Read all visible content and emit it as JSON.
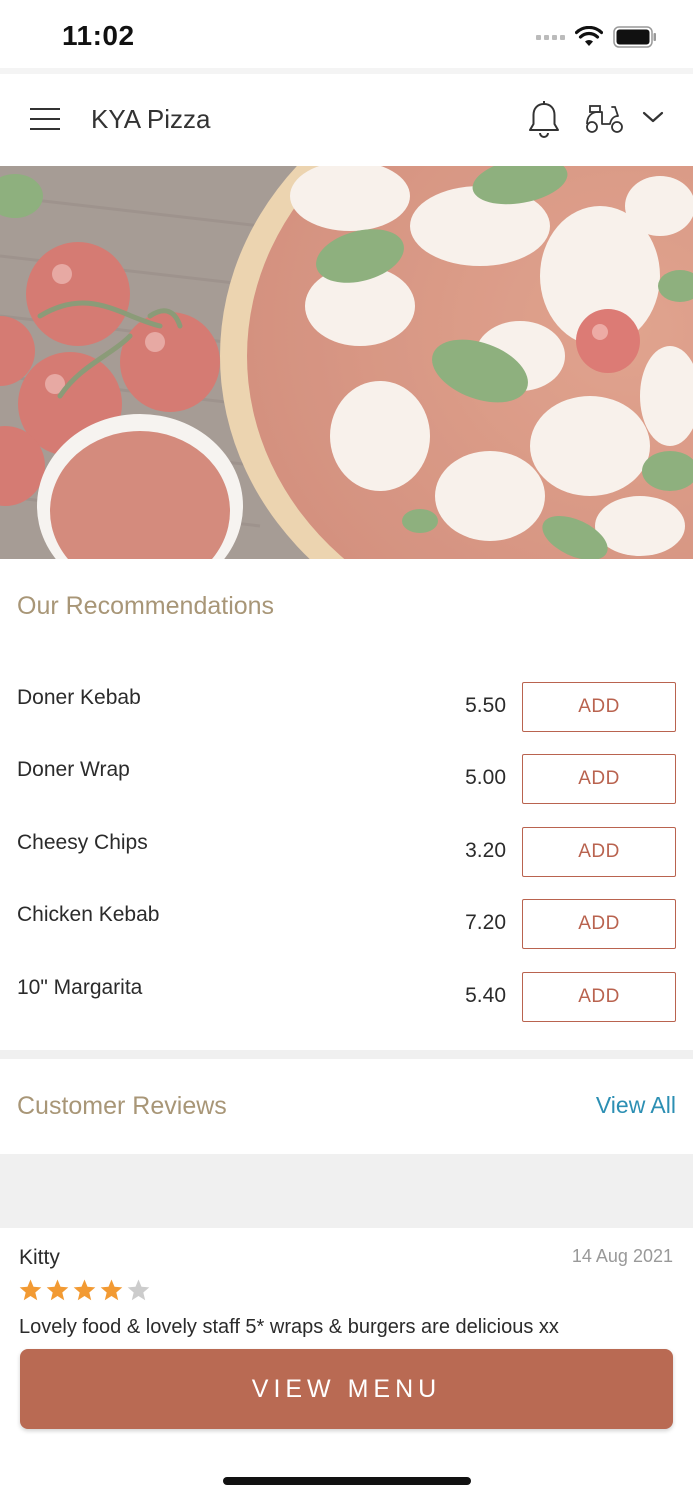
{
  "status_bar": {
    "time": "11:02"
  },
  "header": {
    "title": "KYA Pizza"
  },
  "recommendations": {
    "title": "Our Recommendations",
    "add_label": "ADD",
    "items": [
      {
        "name": "Doner Kebab",
        "price": "5.50"
      },
      {
        "name": "Doner Wrap",
        "price": "5.00"
      },
      {
        "name": "Cheesy Chips",
        "price": "3.20"
      },
      {
        "name": "Chicken Kebab",
        "price": "7.20"
      },
      {
        "name": "10\" Margarita",
        "price": "5.40"
      }
    ]
  },
  "reviews": {
    "title": "Customer Reviews",
    "view_all": "View All",
    "items": [
      {
        "author": "Kitty",
        "date": "14 Aug 2021",
        "rating": 4,
        "max_rating": 5,
        "text": "Lovely food & lovely staff 5* wraps & burgers are delicious xx"
      }
    ]
  },
  "cta": {
    "label": "VIEW MENU"
  },
  "colors": {
    "accent": "#b9634f",
    "section_title": "#a89677",
    "link": "#2c8fb3",
    "star": "#f29a33"
  },
  "icons": [
    "menu-icon",
    "bell-icon",
    "scooter-icon",
    "chevron-down-icon",
    "wifi-icon",
    "battery-icon",
    "star-icon"
  ]
}
